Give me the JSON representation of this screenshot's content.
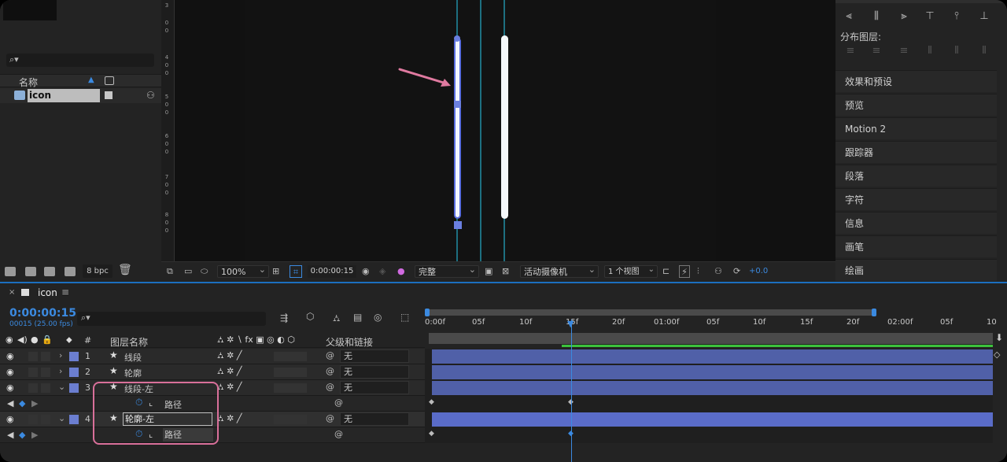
{
  "project": {
    "search_placeholder": "",
    "col_name": "名称",
    "item_name": "icon",
    "bpc": "8 bpc"
  },
  "viewer": {
    "ruler_labels": [
      "3",
      "0",
      "0",
      "4",
      "0",
      "0",
      "5",
      "0",
      "0",
      "6",
      "0",
      "0",
      "7",
      "0",
      "0",
      "8",
      "0",
      "0"
    ],
    "zoom": "100%",
    "timecode": "0:00:00:15",
    "quality": "完整",
    "camera": "活动摄像机",
    "views": "1 个视图",
    "exposure": "+0.0"
  },
  "right_panel": {
    "distribute_label": "分布图层:",
    "items": [
      "效果和预设",
      "预览",
      "Motion 2",
      "跟踪器",
      "段落",
      "字符",
      "信息",
      "画笔",
      "绘画"
    ]
  },
  "timeline": {
    "comp_name": "icon",
    "timecode": "0:00:00:15",
    "timecode_sub": "00015 (25.00 fps)",
    "col_num": "#",
    "col_layer_name": "图层名称",
    "col_parent": "父级和链接",
    "ruler": [
      "0:00f",
      "05f",
      "10f",
      "15f",
      "20f",
      "01:00f",
      "05f",
      "10f",
      "15f",
      "20f",
      "02:00f",
      "05f",
      "10"
    ],
    "layers": [
      {
        "num": "1",
        "name": "线段",
        "parent": "无"
      },
      {
        "num": "2",
        "name": "轮廓",
        "parent": "无"
      },
      {
        "num": "3",
        "name": "线段-左",
        "parent": "无"
      },
      {
        "num": "4",
        "name": "轮廓-左",
        "parent": "无"
      }
    ],
    "path_label": "路径"
  }
}
